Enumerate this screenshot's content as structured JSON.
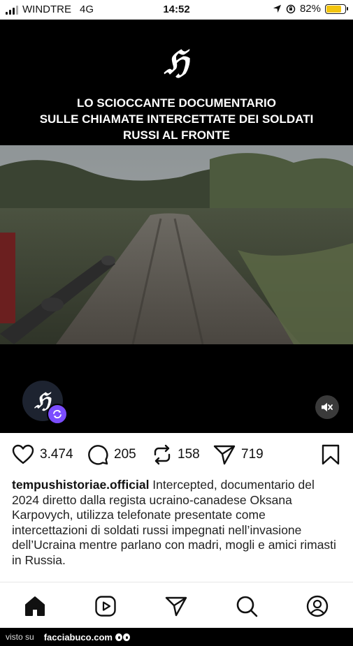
{
  "status_bar": {
    "carrier": "WINDTRE",
    "network": "4G",
    "time": "14:52",
    "battery": "82%",
    "battery_level": 0.82,
    "battery_color": "#f2c40f"
  },
  "video": {
    "headline_line1": "LO SCIOCCANTE DOCUMENTARIO",
    "headline_line2": "SULLE CHIAMATE INTERCETTATE DEI SOLDATI",
    "headline_line3": "RUSSI AL FRONTE",
    "logo_icon": "gothic-h-logo",
    "mute_icon": "muted-speaker-icon",
    "repost_color": "#7b4dff"
  },
  "actions": {
    "likes": "3.474",
    "comments": "205",
    "reposts": "158",
    "shares": "719"
  },
  "caption": {
    "username": "tempushistoriae.official",
    "text": " Intercepted, documentario del 2024 diretto dalla regista ucraino-canadese Oksana Karpovych, utilizza telefonate presentate come intercettazioni di soldati russi impegnati nell’invasione dell’Ucraina mentre parlano con madri, mogli e amici rimasti in Russia."
  },
  "bottom_nav": {
    "items": [
      "home-icon",
      "reels-icon",
      "send-icon",
      "search-icon",
      "profile-icon"
    ]
  },
  "watermark": {
    "prefix": "visto su",
    "site": "facciabuco.com"
  }
}
